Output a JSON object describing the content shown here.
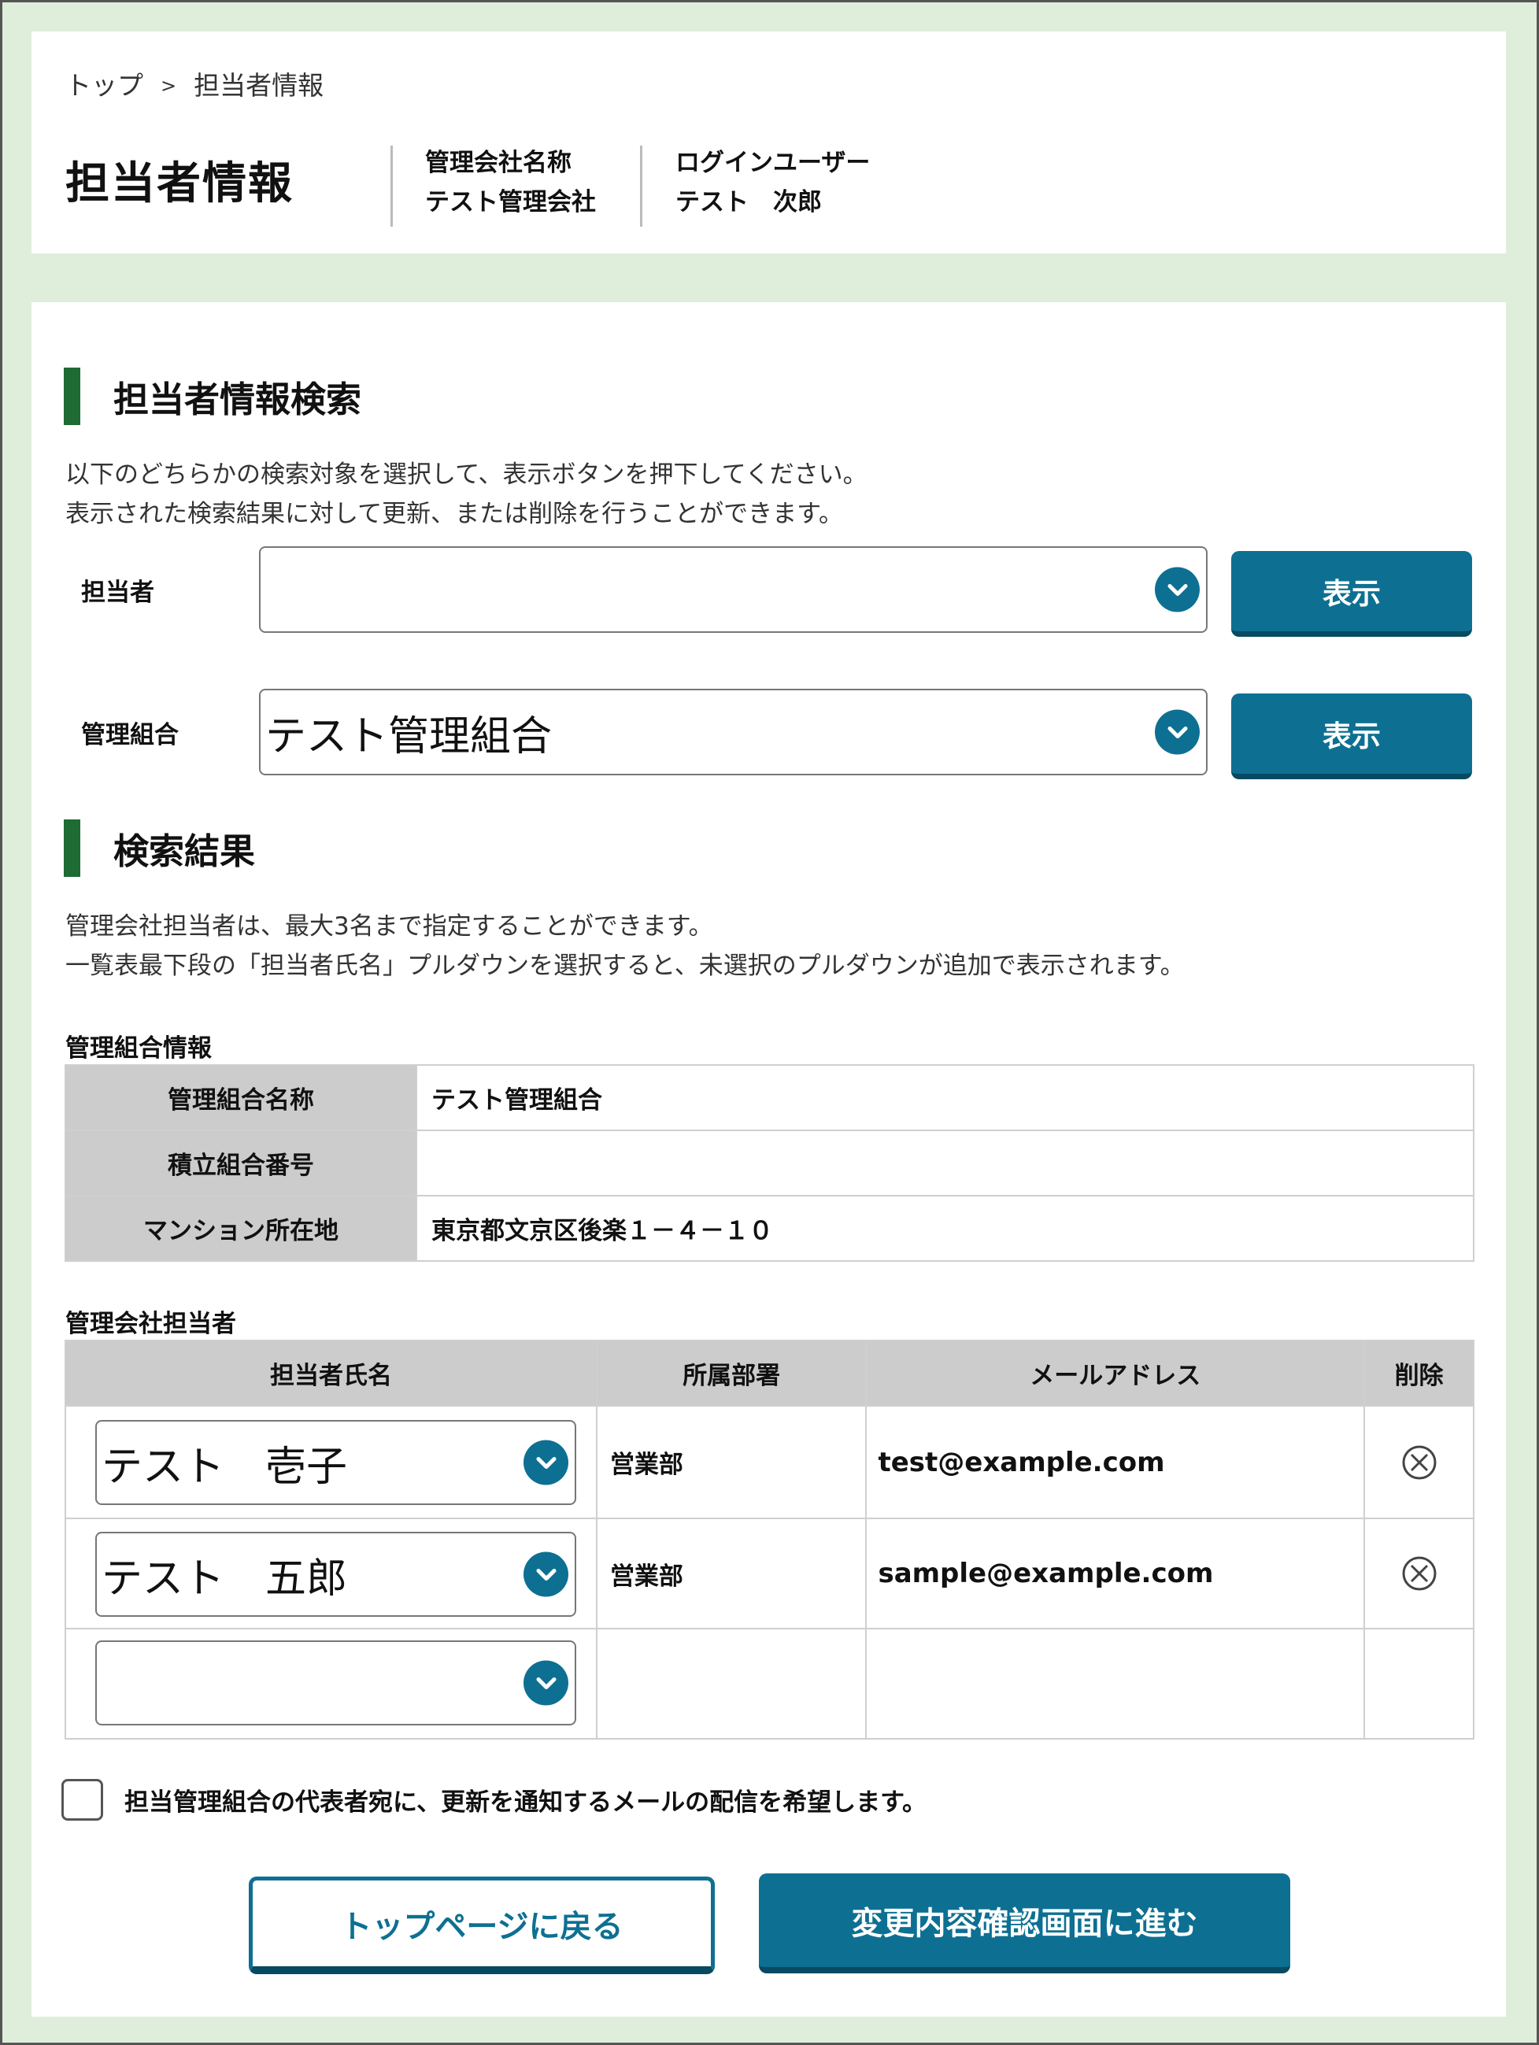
{
  "breadcrumb": {
    "home": "トップ",
    "separator": ">",
    "current": "担当者情報"
  },
  "page_title": "担当者情報",
  "company": {
    "label": "管理会社名称",
    "value": "テスト管理会社"
  },
  "login_user": {
    "label": "ログインユーザー",
    "value": "テスト　次郎"
  },
  "search_section": {
    "title": "担当者情報検索",
    "desc_line1": "以下のどちらかの検索対象を選択して、表示ボタンを押下してください。",
    "desc_line2": "表示された検索結果に対して更新、または削除を行うことができます。",
    "staff_label": "担当者",
    "staff_value": "",
    "union_label": "管理組合",
    "union_value": "テスト管理組合",
    "show_button": "表示"
  },
  "results_section": {
    "title": "検索結果",
    "desc_line1": "管理会社担当者は、最大3名まで指定することができます。",
    "desc_line2": "一覧表最下段の「担当者氏名」プルダウンを選択すると、未選択のプルダウンが追加で表示されます。"
  },
  "union_info": {
    "label": "管理組合情報",
    "rows": [
      {
        "key": "管理組合名称",
        "value": "テスト管理組合"
      },
      {
        "key": "積立組合番号",
        "value": ""
      },
      {
        "key": "マンション所在地",
        "value": "東京都文京区後楽１－４－１０"
      }
    ]
  },
  "staff_table": {
    "label": "管理会社担当者",
    "headers": [
      "担当者氏名",
      "所属部署",
      "メールアドレス",
      "削除"
    ],
    "rows": [
      {
        "name": "テスト　壱子",
        "dept": "営業部",
        "email": "test@example.com"
      },
      {
        "name": "テスト　五郎",
        "dept": "営業部",
        "email": "sample@example.com"
      },
      {
        "name": "",
        "dept": "",
        "email": ""
      }
    ]
  },
  "notify_checkbox": {
    "label": "担当管理組合の代表者宛に、更新を通知するメールの配信を希望します。",
    "checked": false
  },
  "buttons": {
    "back": "トップページに戻る",
    "next": "変更内容確認画面に進む"
  },
  "colors": {
    "accent": "#0d7092",
    "section_bar": "#1e6b33",
    "background": "#dfeedb"
  }
}
